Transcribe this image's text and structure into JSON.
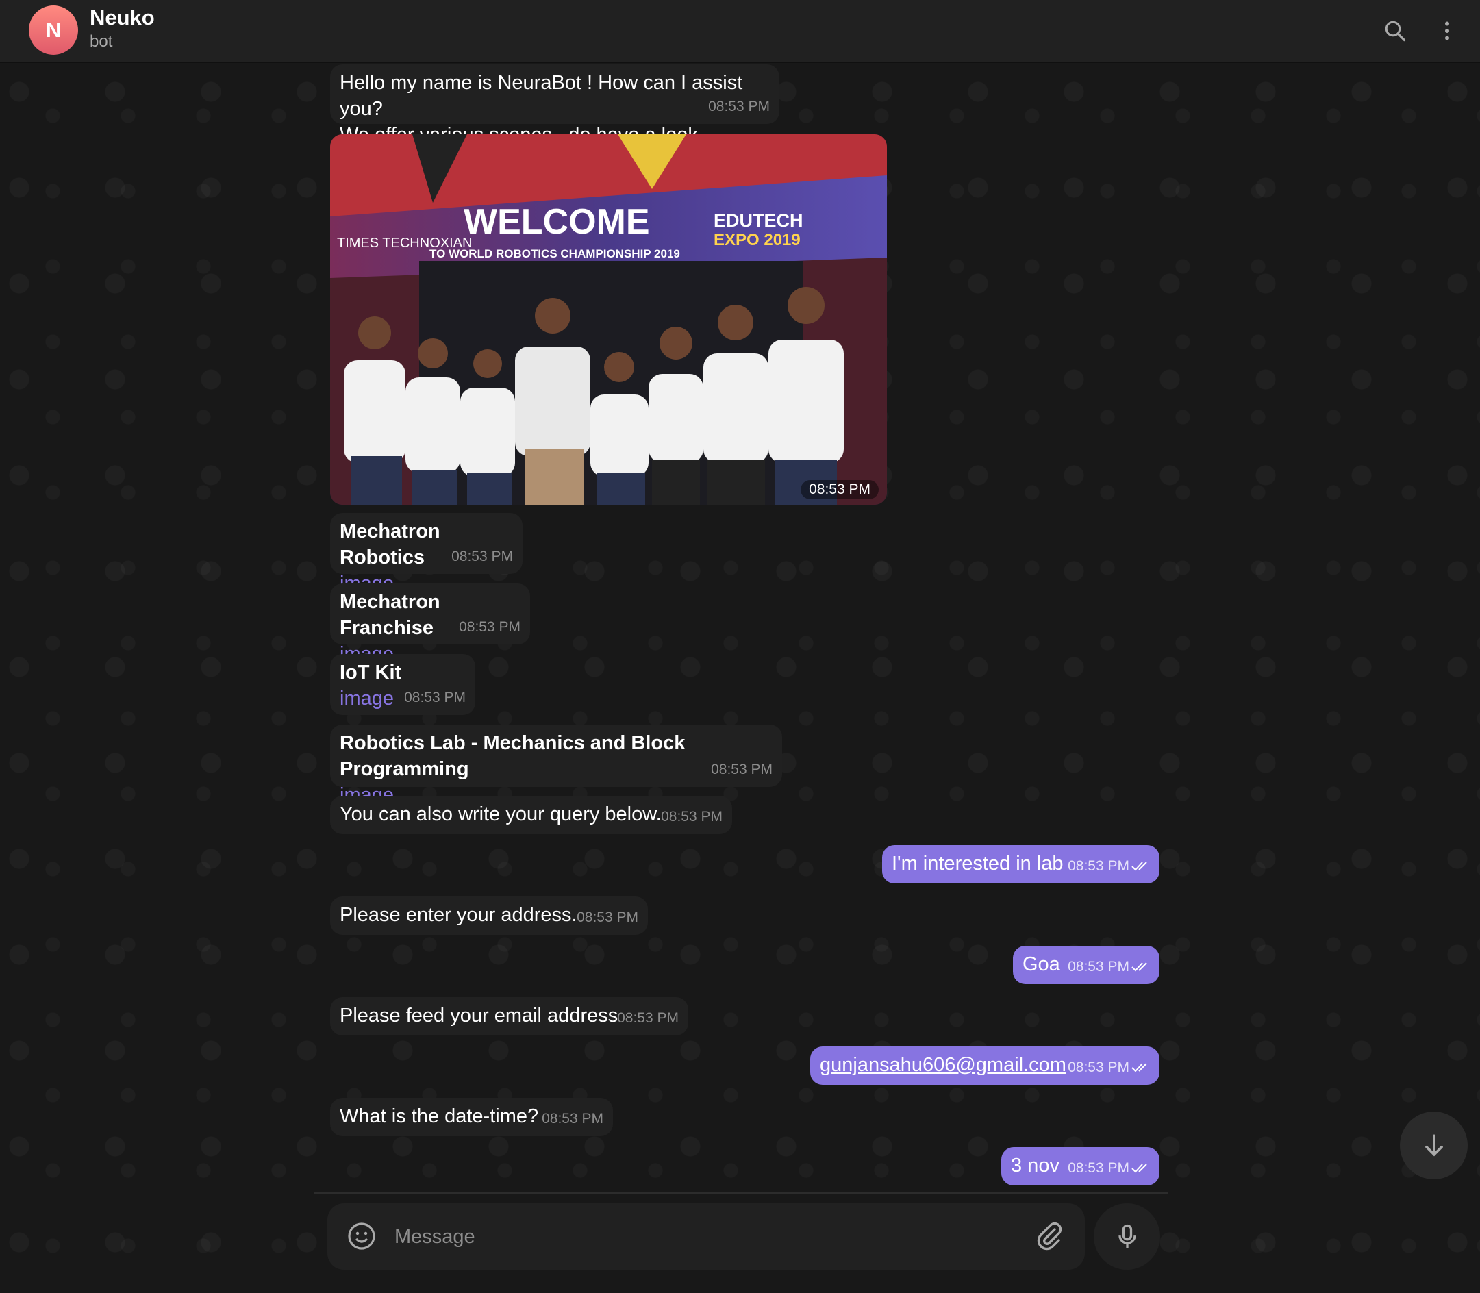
{
  "header": {
    "avatar_letter": "N",
    "name": "Neuko",
    "status": "bot"
  },
  "messages": {
    "welcome": {
      "line1": "Hello my name is NeuraBot ! How can I assist you?",
      "line2": "We offer various scopes , do have a look",
      "time": "08:53 PM"
    },
    "photo": {
      "time": "08:53 PM",
      "banner_welcome": "WELCOME",
      "banner_sub": "TO WORLD ROBOTICS CHAMPIONSHIP 2019",
      "banner_left": "TIMES TECHNOXIAN",
      "banner_right1": "EDUTECH",
      "banner_right2": "EXPO 2019"
    },
    "opt1": {
      "title": "Mechatron Robotics",
      "link": "image",
      "time": "08:53 PM"
    },
    "opt2": {
      "title": "Mechatron Franchise",
      "link": "image",
      "time": "08:53 PM"
    },
    "opt3": {
      "title": "IoT Kit",
      "link": "image",
      "time": "08:53 PM"
    },
    "opt4": {
      "title": "Robotics Lab - Mechanics and Block Programming",
      "link": "image",
      "time": "08:53 PM"
    },
    "query": {
      "text": "You can also write your query below.",
      "time": "08:53 PM"
    },
    "out1": {
      "text": "I'm interested in lab",
      "time": "08:53 PM"
    },
    "address": {
      "text": "Please enter your address.",
      "time": "08:53 PM"
    },
    "out2": {
      "text": "Goa",
      "time": "08:53 PM"
    },
    "email": {
      "text": "Please feed your email address",
      "time": "08:53 PM"
    },
    "out3": {
      "text": "gunjansahu606@gmail.com",
      "time": "08:53 PM"
    },
    "date": {
      "text": "What is the date-time?",
      "time": "08:53 PM"
    },
    "out4": {
      "text": "3 nov",
      "time": "08:53 PM"
    }
  },
  "composer": {
    "placeholder": "Message"
  },
  "colors": {
    "accent": "#8774e1",
    "bubble_in": "#212121",
    "background": "#181818"
  }
}
